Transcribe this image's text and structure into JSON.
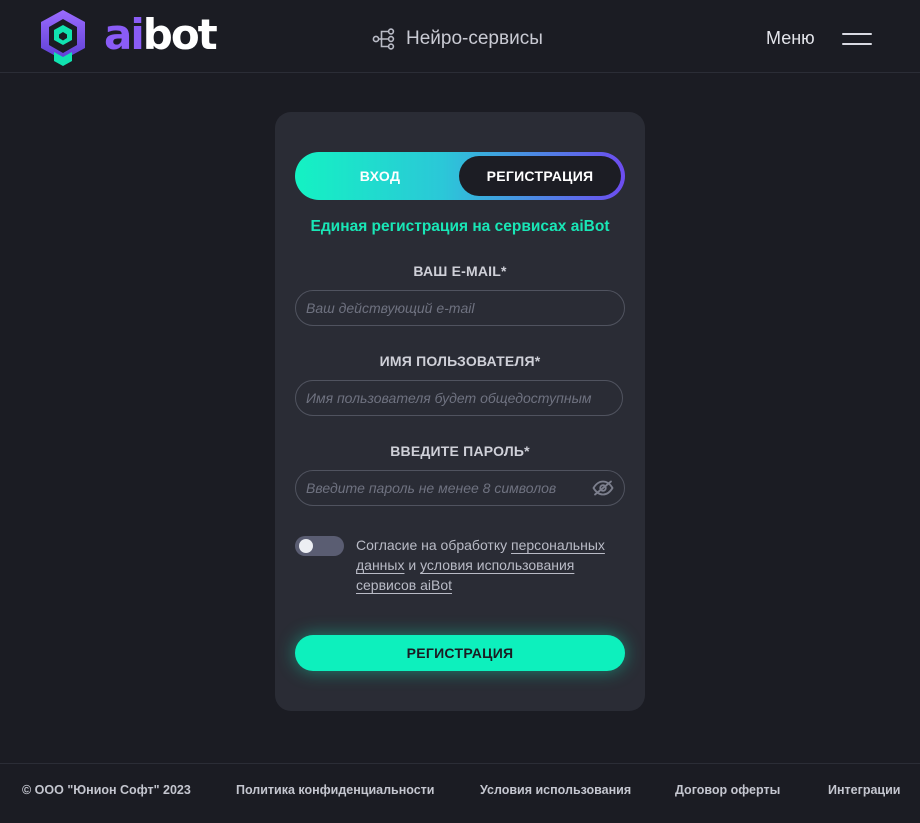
{
  "header": {
    "logo_text_ai": "ai",
    "logo_text_bot": "bot",
    "services_label": "Нейро-сервисы",
    "menu_label": "Меню"
  },
  "auth": {
    "tabs": {
      "login": "ВХОД",
      "register": "РЕГИСТРАЦИЯ",
      "active": "register"
    },
    "subtitle": "Единая регистрация на сервисах aiBot",
    "fields": {
      "email": {
        "label": "ВАШ E-MAIL*",
        "placeholder": "Ваш действующий e-mail",
        "value": ""
      },
      "username": {
        "label": "ИМЯ ПОЛЬЗОВАТЕЛЯ*",
        "placeholder": "Имя пользователя будет общедоступным",
        "value": ""
      },
      "password": {
        "label": "ВВЕДИТЕ ПАРОЛЬ*",
        "placeholder": "Введите пароль не менее 8 символов",
        "value": "",
        "icon": "eye-slash-icon"
      }
    },
    "consent": {
      "checked": false,
      "text_before": "Согласие на обработку ",
      "link_personal_data": "персональных данных",
      "text_and": " и ",
      "link_terms": "условия использования сервисов aiBot"
    },
    "submit_label": "РЕГИСТРАЦИЯ"
  },
  "footer": {
    "copyright": "© ООО \"Юнион Софт\" 2023",
    "links": {
      "privacy": "Политика конфиденциальности",
      "terms": "Условия использования",
      "offer": "Договор оферты",
      "integrations": "Интеграции"
    }
  },
  "colors": {
    "background": "#1b1c23",
    "card": "#2a2c35",
    "accent_green": "#0df0bd",
    "accent_purple": "#6d4cf0",
    "brand_purple": "#8a5cf6"
  }
}
